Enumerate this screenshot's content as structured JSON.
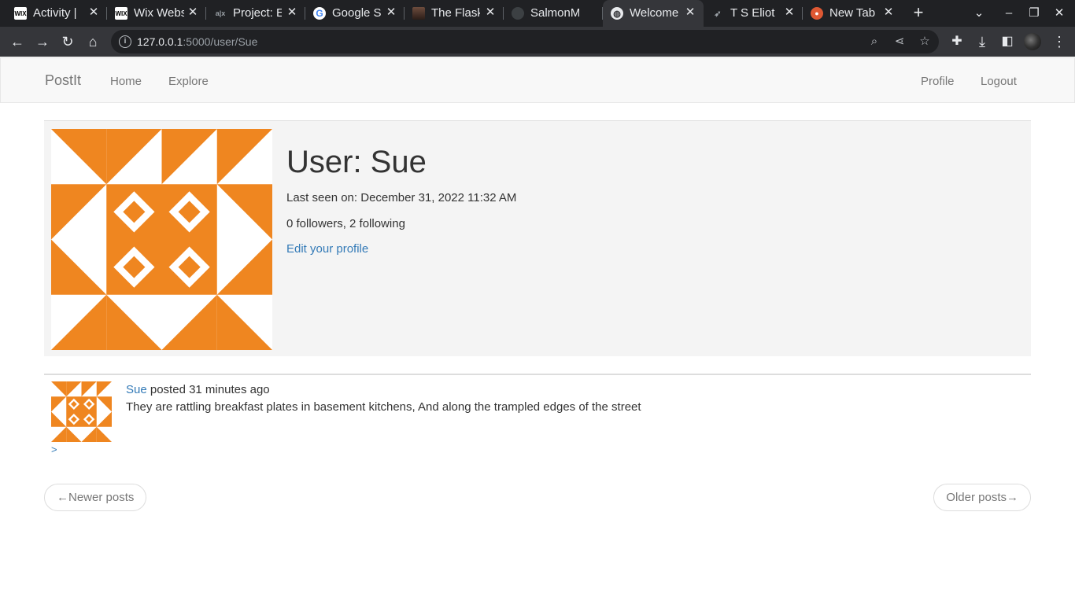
{
  "browser": {
    "tabs": [
      {
        "title": "Activity |",
        "favicon": "wix"
      },
      {
        "title": "Wix Webs",
        "favicon": "wix"
      },
      {
        "title": "Project: E",
        "favicon": "project"
      },
      {
        "title": "Google S",
        "favicon": "google"
      },
      {
        "title": "The Flask",
        "favicon": "photo"
      },
      {
        "title": "SalmonM",
        "favicon": "github"
      },
      {
        "title": "Welcome",
        "favicon": "globe",
        "active": true
      },
      {
        "title": "T S Eliot",
        "favicon": "bird"
      },
      {
        "title": "New Tab",
        "favicon": "duckduckgo"
      }
    ],
    "url_host": "127.0.0.1",
    "url_path": ":5000/user/Sue"
  },
  "navbar": {
    "brand": "PostIt",
    "links": {
      "home": "Home",
      "explore": "Explore",
      "profile": "Profile",
      "logout": "Logout"
    }
  },
  "profile": {
    "heading": "User: Sue",
    "last_seen": "Last seen on: December 31, 2022 11:32 AM",
    "follow_stats": "0 followers, 2 following",
    "edit_link": "Edit your profile",
    "avatar_color": "#ef8620"
  },
  "posts": [
    {
      "author": "Sue",
      "meta": " posted 31 minutes ago",
      "body": "They are rattling breakfast plates in basement kitchens, And along the trampled edges of the street",
      "more": ">"
    }
  ],
  "pager": {
    "newer": "←Newer posts",
    "older": "Older posts→"
  }
}
